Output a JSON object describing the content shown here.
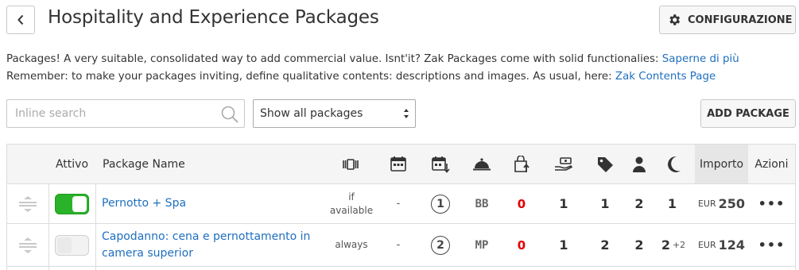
{
  "header": {
    "title": "Hospitality and Experience Packages",
    "config_label": "CONFIGURAZIONE",
    "back_icon": "chevron-left-icon",
    "config_icon": "gear-icon"
  },
  "intro": {
    "line1_text": "Packages! A very suitable, consolidated way to add commercial value. Isnt'it? Zak Packages come with solid functionalies: ",
    "line1_link": "Saperne di più",
    "line2_text": "Remember: to make your packages inviting, define qualitative contents: descriptions and images. As usual, here: ",
    "line2_link": "Zak Contents Page"
  },
  "toolbar": {
    "search_placeholder": "Inline search",
    "filter_value": "Show all packages",
    "add_label": "ADD PACKAGE"
  },
  "table": {
    "headers": {
      "attivo": "Attivo",
      "package_name": "Package Name",
      "importo": "Importo",
      "azioni": "Azioni"
    },
    "header_icons": [
      "availability-icon",
      "calendar-icon",
      "calendar-download-icon",
      "cloche-icon",
      "bag-upload-icon",
      "hand-money-icon",
      "tag-icon",
      "person-icon",
      "moon-icon"
    ],
    "rows": [
      {
        "active": true,
        "name": "Pernotto + Spa",
        "availability": "if available",
        "date_range": "-",
        "nights_circle": "1",
        "board": "BB",
        "col_red": "0",
        "col_hand": "1",
        "col_tag": "1",
        "col_person": "2",
        "col_moon": "1",
        "col_moon_extra": "",
        "currency": "EUR",
        "price": "250",
        "actions": "•••"
      },
      {
        "active": false,
        "name": "Capodanno: cena e pernottamento in camera superior",
        "availability": "always",
        "date_range": "-",
        "nights_circle": "2",
        "board": "MP",
        "col_red": "0",
        "col_hand": "1",
        "col_tag": "2",
        "col_person": "2",
        "col_moon": "2",
        "col_moon_extra": "+2",
        "currency": "EUR",
        "price": "124",
        "actions": "•••"
      }
    ]
  }
}
